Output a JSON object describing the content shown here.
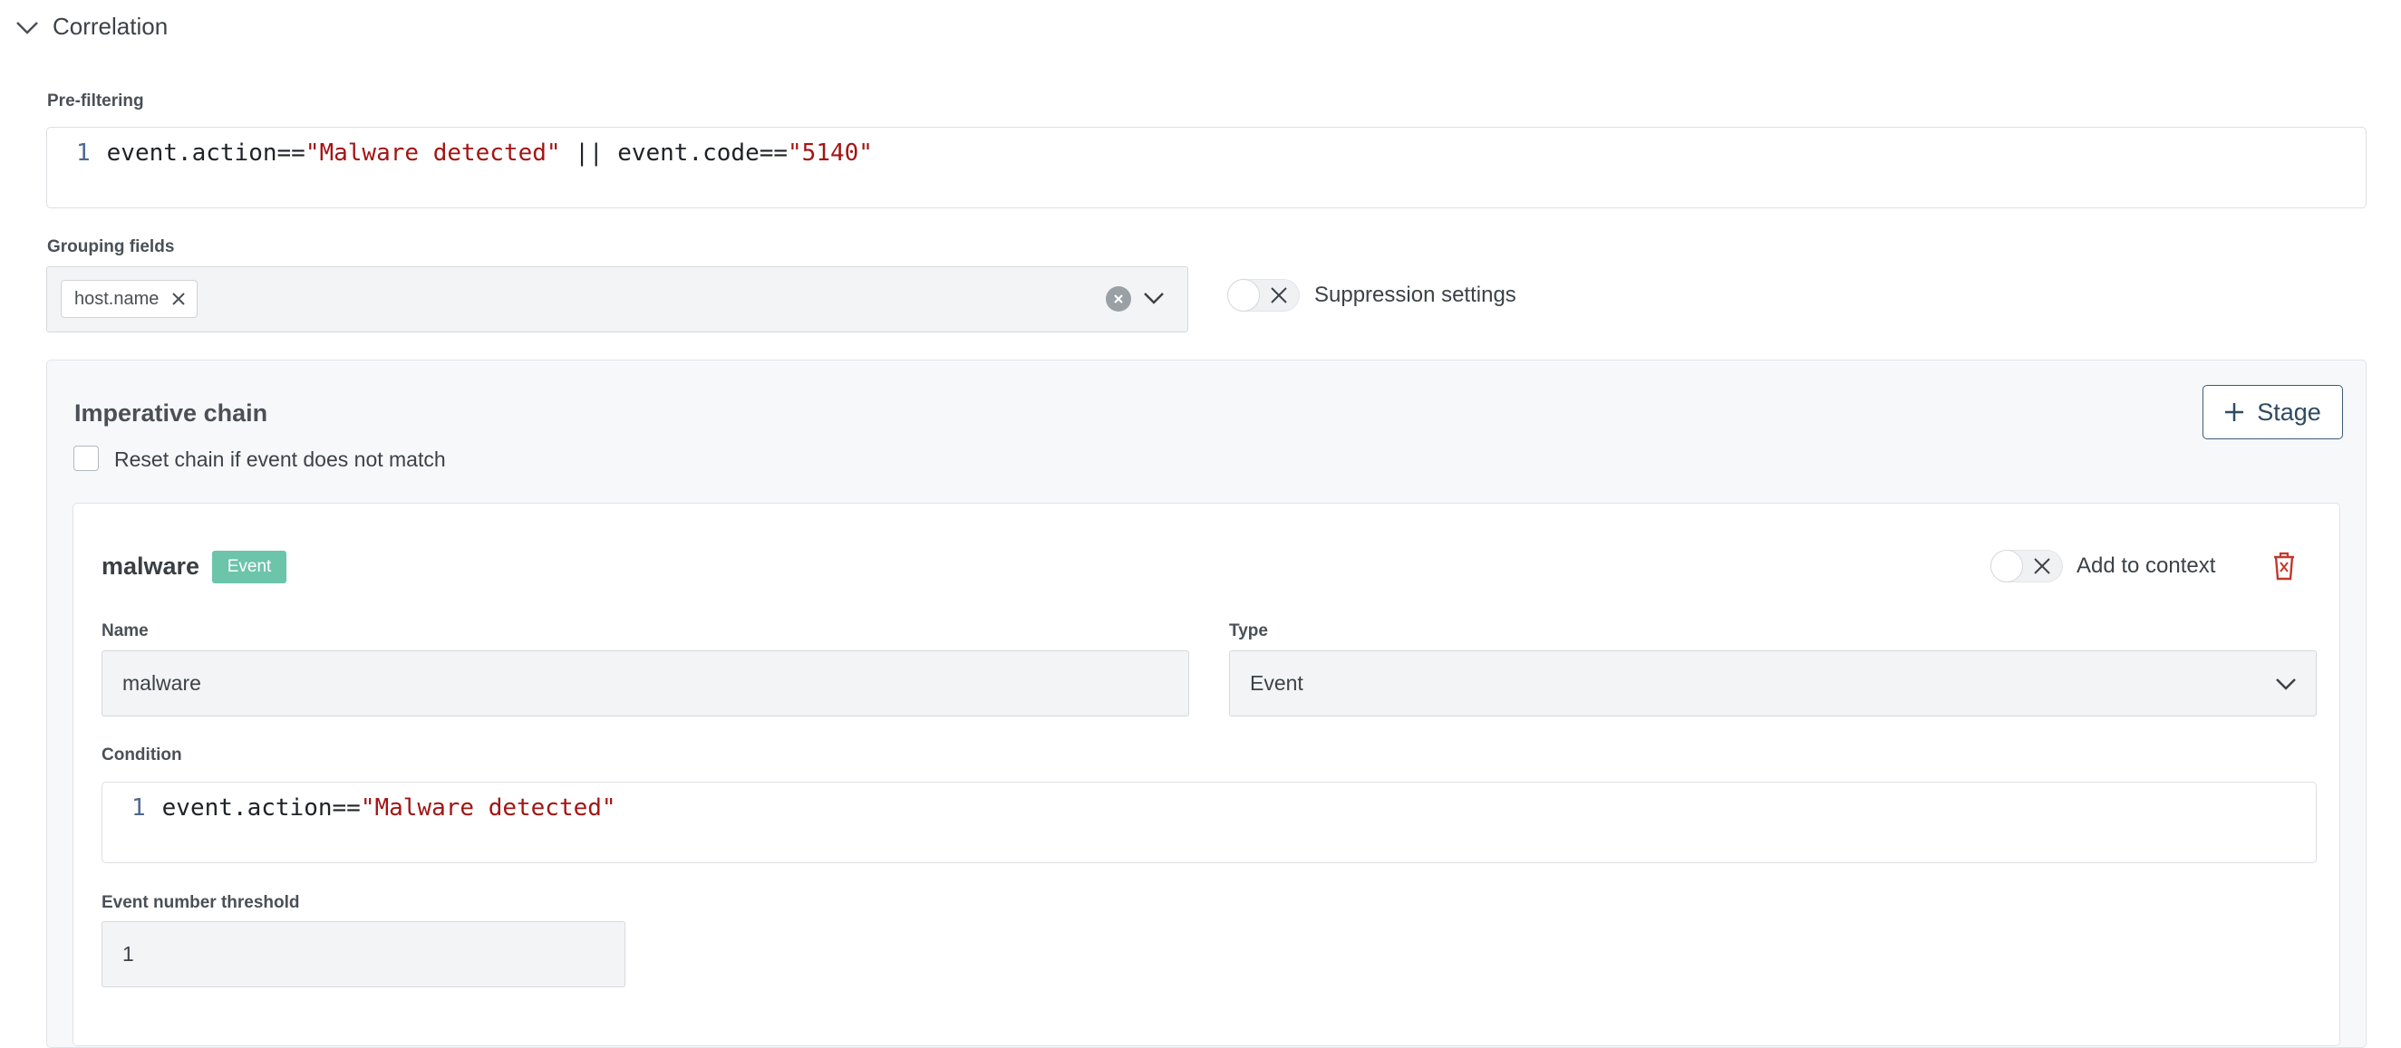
{
  "section": {
    "title": "Correlation",
    "chevron_icon": "chevron-down-icon"
  },
  "prefilter": {
    "label": "Pre-filtering",
    "line_number": "1",
    "code": {
      "p1": "event.action==",
      "s1": "\"Malware detected\"",
      "p2": " || event.code==",
      "s2": "\"5140\""
    }
  },
  "grouping": {
    "label": "Grouping fields",
    "tags": [
      "host.name"
    ],
    "clear_icon": "clear-circle-icon",
    "dropdown_icon": "chevron-down-icon"
  },
  "suppression": {
    "label": "Suppression settings",
    "enabled": false
  },
  "chain": {
    "title": "Imperative chain",
    "add_stage_label": "Stage",
    "reset_label": "Reset chain if event does not match",
    "reset_checked": false
  },
  "stage": {
    "title": "malware",
    "badge": "Event",
    "add_to_context_label": "Add to context",
    "add_to_context_enabled": false,
    "delete_icon": "trash-icon",
    "name_label": "Name",
    "name_value": "malware",
    "type_label": "Type",
    "type_value": "Event",
    "condition_label": "Condition",
    "condition_line_number": "1",
    "condition_code": {
      "p1": "event.action==",
      "s1": "\"Malware detected\""
    },
    "threshold_label": "Event number threshold",
    "threshold_value": "1"
  },
  "colors": {
    "accent": "#3f5a73",
    "badge": "#6cc4a9",
    "string": "#a31515",
    "delete": "#c0392b"
  }
}
